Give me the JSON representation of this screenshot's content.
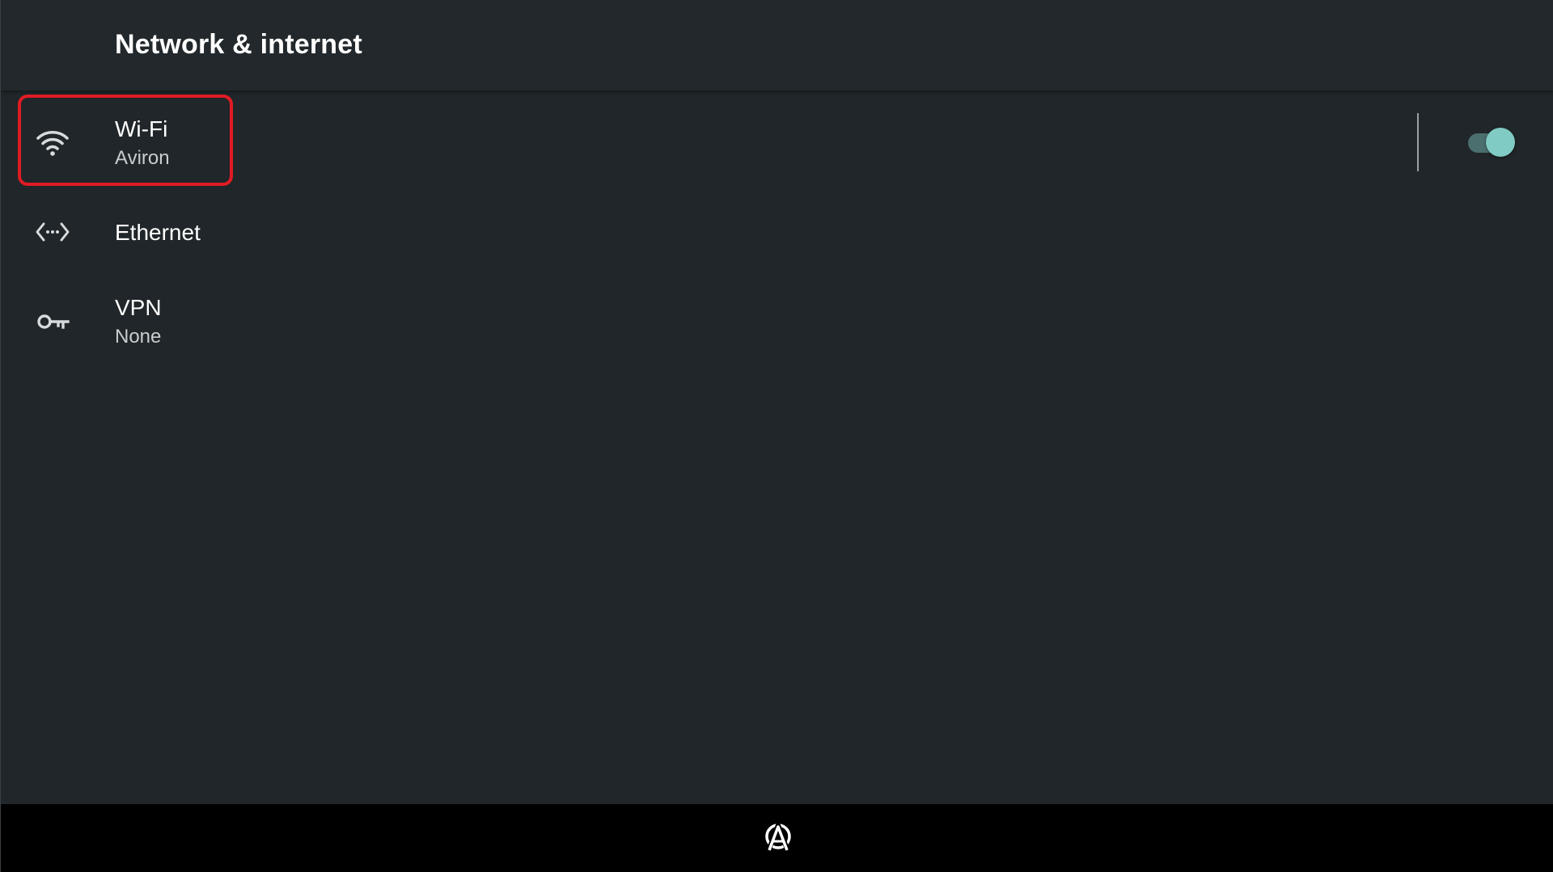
{
  "header": {
    "title": "Network & internet"
  },
  "items": [
    {
      "id": "wifi",
      "icon": "wifi-icon",
      "label": "Wi-Fi",
      "summary": "Aviron",
      "toggle": {
        "state": "on"
      }
    },
    {
      "id": "ethernet",
      "icon": "ethernet-icon",
      "label": "Ethernet"
    },
    {
      "id": "vpn",
      "icon": "key-icon",
      "label": "VPN",
      "summary": "None"
    }
  ],
  "colors": {
    "background": "#202629",
    "header": "#22282b",
    "focus_outline": "#e01b24",
    "toggle_thumb": "#80cbc4",
    "toggle_track": "#4b6e6e",
    "nav_bar": "#000000"
  },
  "nav": {
    "logo": "aviron-logo-icon"
  }
}
